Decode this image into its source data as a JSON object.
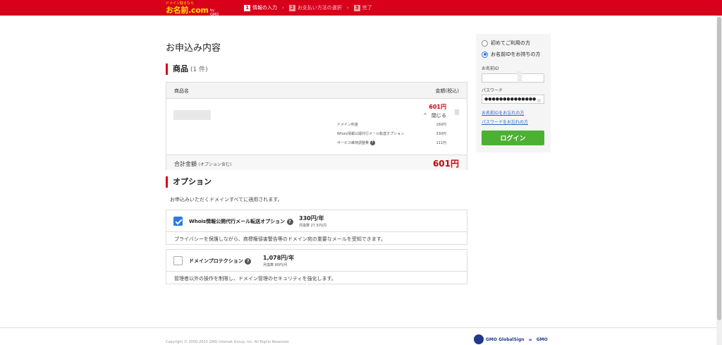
{
  "header": {
    "logo_small": "ドメイン取るなら",
    "logo_main": "お名前.com",
    "logo_gmo": "by GMO",
    "steps": [
      {
        "num": "1",
        "label": "情報の入力"
      },
      {
        "num": "2",
        "label": "お支払い方法の選択"
      },
      {
        "num": "3",
        "label": "完了"
      }
    ],
    "step_separator": "›"
  },
  "main": {
    "title": "お申込み内容",
    "products_heading": "商品",
    "products_count": "(1 件)",
    "table_headers": {
      "name": "商品名",
      "price": "金額(税込)"
    },
    "product": {
      "price": "601円",
      "toggle_chevron": "^",
      "toggle_label": "閉じる",
      "details": [
        {
          "label": "ドメイン料金",
          "value": "160円"
        },
        {
          "label": "Whois情報公開代行メール転送オプション",
          "value": "330円"
        },
        {
          "label": "サービス維持調整費",
          "value": "111円"
        }
      ]
    },
    "total": {
      "label": "合計金額",
      "note": "(オプション含む)",
      "value": "601円"
    },
    "options_heading": "オプション",
    "options_description": "お申込みいただくドメインすべてに適用されます。",
    "options": [
      {
        "name": "Whois情報公開代行メール転送オプション",
        "checked": true,
        "price": "330円/年",
        "monthly": "月換算 27.5円/月",
        "description": "プライバシーを保護しながら、商標権侵害警告等のドメイン宛の重要なメールを受知できます。"
      },
      {
        "name": "ドメインプロテクション",
        "checked": false,
        "price": "1,078円/年",
        "monthly": "月換算 90円/月",
        "description": "管理者以外の操作を制限し、ドメイン管理のセキュリティを強化します。"
      }
    ],
    "help_glyph": "?"
  },
  "sidebar": {
    "radio_new": "初めてご利用の方",
    "radio_existing": "お名前IDをお持ちの方",
    "id_label": "お名前ID",
    "id_value": "",
    "password_label": "パスワード",
    "password_value": "●●●●●●●●●●●●●●",
    "eye_glyph": "◎",
    "forgot_id": "お名前IDをお忘れの方",
    "forgot_password": "パスワードをお忘れの方",
    "login_button": "ログイン"
  },
  "footer": {
    "copyright": "Copyright © 2000-2023 GMO Internet Group, Inc. All Rights Reserved.",
    "logo_a": "GMO GlobalSign",
    "logo_chevrons": "»",
    "logo_b": "GMO"
  },
  "colors": {
    "brand_red": "#d8001a",
    "price_red": "#c7000b",
    "login_green": "#4cb033",
    "checkbox_blue": "#2b7be0",
    "link_blue": "#2b62c8"
  }
}
